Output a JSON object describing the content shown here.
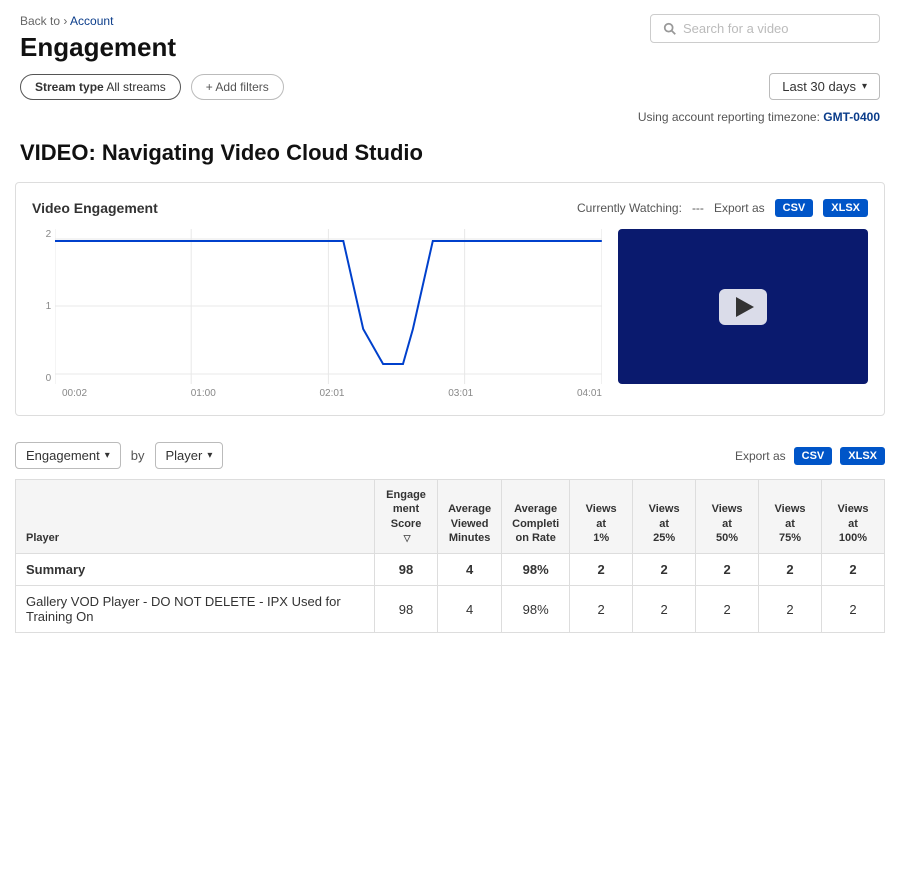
{
  "breadcrumb": {
    "back_label": "Back to",
    "link_label": "Account",
    "separator": "›"
  },
  "page": {
    "title": "Engagement",
    "search_placeholder": "Search for a video"
  },
  "filters": {
    "stream_type_label": "Stream type",
    "stream_type_value": "All streams",
    "add_filter_label": "+ Add filters",
    "date_range": "Last 30 days"
  },
  "timezone": {
    "prefix": "Using account reporting timezone:",
    "value": "GMT-0400"
  },
  "video": {
    "title": "VIDEO: Navigating Video Cloud Studio"
  },
  "chart": {
    "title": "Video Engagement",
    "currently_watching_label": "Currently Watching:",
    "currently_watching_value": "---",
    "export_label": "Export as",
    "csv_label": "CSV",
    "xlsx_label": "XLSX",
    "x_labels": [
      "00:02",
      "01:00",
      "02:01",
      "03:01",
      "04:01"
    ],
    "y_labels": [
      "2",
      "1",
      "0"
    ]
  },
  "table_controls": {
    "engagement_label": "Engagement",
    "by_label": "by",
    "player_label": "Player",
    "export_label": "Export as",
    "csv_label": "CSV",
    "xlsx_label": "XLSX"
  },
  "table": {
    "headers": [
      "Player",
      "Engagement Score",
      "Average Viewed Minutes",
      "Average Completion Rate",
      "Views at 1%",
      "Views at 25%",
      "Views at 50%",
      "Views at 75%",
      "Views at 100%"
    ],
    "summary": {
      "label": "Summary",
      "engagement_score": "98",
      "avg_viewed_minutes": "4",
      "avg_completion_rate": "98%",
      "views_1": "2",
      "views_25": "2",
      "views_50": "2",
      "views_75": "2",
      "views_100": "2"
    },
    "rows": [
      {
        "player": "Gallery VOD Player - DO NOT DELETE - IPX Used for Training On",
        "engagement_score": "98",
        "avg_viewed_minutes": "4",
        "avg_completion_rate": "98%",
        "views_1": "2",
        "views_25": "2",
        "views_50": "2",
        "views_75": "2",
        "views_100": "2"
      }
    ]
  }
}
